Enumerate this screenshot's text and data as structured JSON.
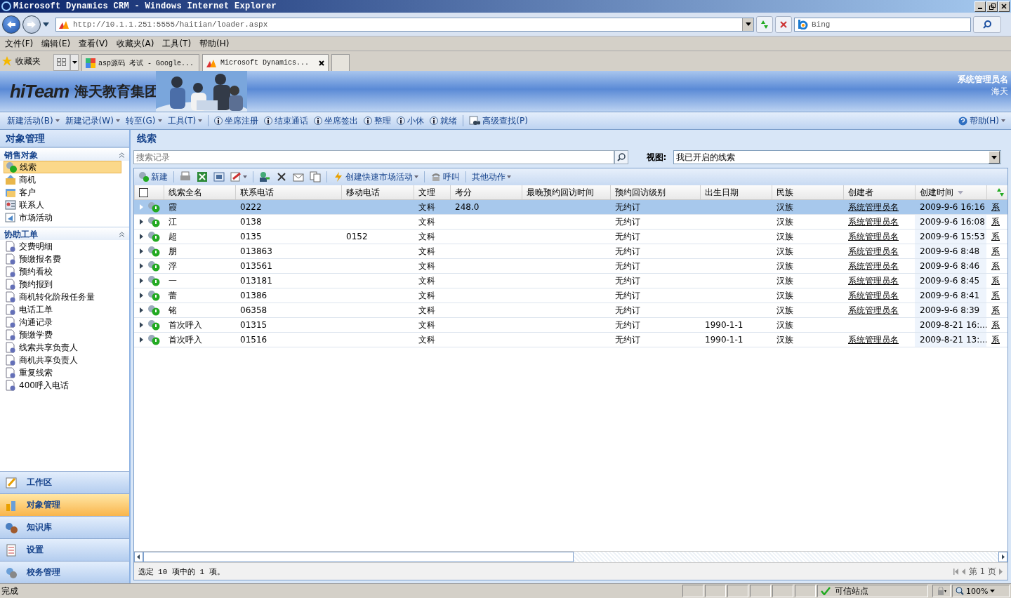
{
  "window": {
    "title": "Microsoft Dynamics CRM - Windows Internet Explorer"
  },
  "address_bar": {
    "value": "http://10.1.1.251:5555/haitian/loader.aspx"
  },
  "search": {
    "value": "Bing"
  },
  "menu_bar": [
    "文件(F)",
    "编辑(E)",
    "查看(V)",
    "收藏夹(A)",
    "工具(T)",
    "帮助(H)"
  ],
  "favorites": {
    "label": "收藏夹"
  },
  "browser_tabs": [
    {
      "label": "asp源码 考试 - Google...",
      "selected": false
    },
    {
      "label": "Microsoft Dynamics...",
      "selected": true
    }
  ],
  "banner": {
    "logo": "hiTeam",
    "company": "海天教育集团",
    "user": "系统管理员名",
    "org": "海天"
  },
  "nav_toolbar": [
    {
      "label": "新建活动(B)",
      "kind": "menu"
    },
    {
      "label": "新建记录(W)",
      "kind": "menu"
    },
    {
      "label": "转至(G)",
      "kind": "menu"
    },
    {
      "label": "工具(T)",
      "kind": "menu"
    },
    {
      "label": "坐席注册",
      "kind": "info"
    },
    {
      "label": "结束通话",
      "kind": "info"
    },
    {
      "label": "坐席签出",
      "kind": "info"
    },
    {
      "label": "整理",
      "kind": "info"
    },
    {
      "label": "小休",
      "kind": "info"
    },
    {
      "label": "就绪",
      "kind": "info"
    },
    {
      "label": "高级查找(P)",
      "kind": "find"
    }
  ],
  "help": {
    "label": "帮助(H)"
  },
  "sidebar": {
    "title": "对象管理",
    "sections": [
      {
        "title": "销售对象",
        "expanded": true,
        "items": [
          {
            "label": "线索",
            "selected": true,
            "kind": "lead"
          },
          {
            "label": "商机",
            "selected": false,
            "kind": "opportunity"
          },
          {
            "label": "客户",
            "selected": false,
            "kind": "account"
          },
          {
            "label": "联系人",
            "selected": false,
            "kind": "contact"
          },
          {
            "label": "市场活动",
            "selected": false,
            "kind": "campaign"
          }
        ]
      },
      {
        "title": "协助工单",
        "expanded": true,
        "items": [
          {
            "label": "交费明细",
            "selected": false,
            "kind": "doc"
          },
          {
            "label": "预缴报名费",
            "selected": false,
            "kind": "doc"
          },
          {
            "label": "预约看校",
            "selected": false,
            "kind": "doc"
          },
          {
            "label": "预约报到",
            "selected": false,
            "kind": "doc"
          },
          {
            "label": "商机转化阶段任务量",
            "selected": false,
            "kind": "doc"
          },
          {
            "label": "电话工单",
            "selected": false,
            "kind": "doc"
          },
          {
            "label": "沟通记录",
            "selected": false,
            "kind": "doc"
          },
          {
            "label": "预缴学费",
            "selected": false,
            "kind": "doc"
          },
          {
            "label": "线索共享负责人",
            "selected": false,
            "kind": "doc"
          },
          {
            "label": "商机共享负责人",
            "selected": false,
            "kind": "doc"
          },
          {
            "label": "重复线索",
            "selected": false,
            "kind": "doc"
          },
          {
            "label": "400呼入电话",
            "selected": false,
            "kind": "doc"
          }
        ]
      }
    ]
  },
  "workspace_nav": [
    {
      "label": "工作区",
      "selected": false
    },
    {
      "label": "对象管理",
      "selected": true
    },
    {
      "label": "知识库",
      "selected": false
    },
    {
      "label": "设置",
      "selected": false
    },
    {
      "label": "校务管理",
      "selected": false
    }
  ],
  "content": {
    "title": "线索",
    "search_placeholder": "搜索记录",
    "view_label": "视图:",
    "view_value": "我已开启的线索"
  },
  "grid_toolbar": [
    {
      "label": "新建",
      "kind": "new"
    },
    {
      "kind": "print"
    },
    {
      "kind": "excel"
    },
    {
      "kind": "word"
    },
    {
      "kind": "edit"
    },
    {
      "kind": "assign"
    },
    {
      "kind": "delete"
    },
    {
      "kind": "mail"
    },
    {
      "kind": "copy"
    },
    {
      "label": "创建快速市场活动",
      "kind": "campaign"
    },
    {
      "label": "呼叫",
      "kind": "phone"
    },
    {
      "label": "其他动作",
      "kind": "more"
    }
  ],
  "table": {
    "select_all": {
      "checked": false
    },
    "columns": [
      "线索全名",
      "联系电话",
      "移动电话",
      "文理",
      "考分",
      "最晚预约回访时间",
      "预约回访级别",
      "出生日期",
      "民族",
      "创建者",
      "创建时间"
    ],
    "rows": [
      {
        "selected": true,
        "cells": [
          "霞",
          "0222",
          "",
          "文科",
          "248.0",
          "",
          "无约订",
          "",
          "汉族",
          "系统管理员名",
          "2009-9-6 16:16",
          "系"
        ]
      },
      {
        "selected": false,
        "cells": [
          "江",
          "0138",
          "",
          "文科",
          "",
          "",
          "无约订",
          "",
          "汉族",
          "系统管理员名",
          "2009-9-6 16:08",
          "系"
        ]
      },
      {
        "selected": false,
        "cells": [
          "超",
          "0135",
          "0152",
          "文科",
          "",
          "",
          "无约订",
          "",
          "汉族",
          "系统管理员名",
          "2009-9-6 15:53",
          "系"
        ]
      },
      {
        "selected": false,
        "cells": [
          "朋",
          "013863",
          "",
          "文科",
          "",
          "",
          "无约订",
          "",
          "汉族",
          "系统管理员名",
          "2009-9-6 8:48",
          "系"
        ]
      },
      {
        "selected": false,
        "cells": [
          "浮",
          "013561",
          "",
          "文科",
          "",
          "",
          "无约订",
          "",
          "汉族",
          "系统管理员名",
          "2009-9-6 8:46",
          "系"
        ]
      },
      {
        "selected": false,
        "cells": [
          "一",
          "013181",
          "",
          "文科",
          "",
          "",
          "无约订",
          "",
          "汉族",
          "系统管理员名",
          "2009-9-6 8:45",
          "系"
        ]
      },
      {
        "selected": false,
        "cells": [
          "蕾",
          "01386",
          "",
          "文科",
          "",
          "",
          "无约订",
          "",
          "汉族",
          "系统管理员名",
          "2009-9-6 8:41",
          "系"
        ]
      },
      {
        "selected": false,
        "cells": [
          "铭",
          "06358",
          "",
          "文科",
          "",
          "",
          "无约订",
          "",
          "汉族",
          "系统管理员名",
          "2009-9-6 8:39",
          "系"
        ]
      },
      {
        "selected": false,
        "cells": [
          "首次呼入",
          "01315",
          "",
          "文科",
          "",
          "",
          "无约订",
          "1990-1-1",
          "汉族",
          "",
          "2009-8-21 16:...",
          "系"
        ]
      },
      {
        "selected": false,
        "cells": [
          "首次呼入",
          "01516",
          "",
          "文科",
          "",
          "",
          "无约订",
          "1990-1-1",
          "汉族",
          "系统管理员名",
          "2009-8-21 13:...",
          "系"
        ]
      }
    ]
  },
  "footer": {
    "summary": "选定 10 项中的 1 项。",
    "page": "第 1 页"
  },
  "status_bar": {
    "text": "完成",
    "zone": "可信站点",
    "zoom": "100%"
  }
}
